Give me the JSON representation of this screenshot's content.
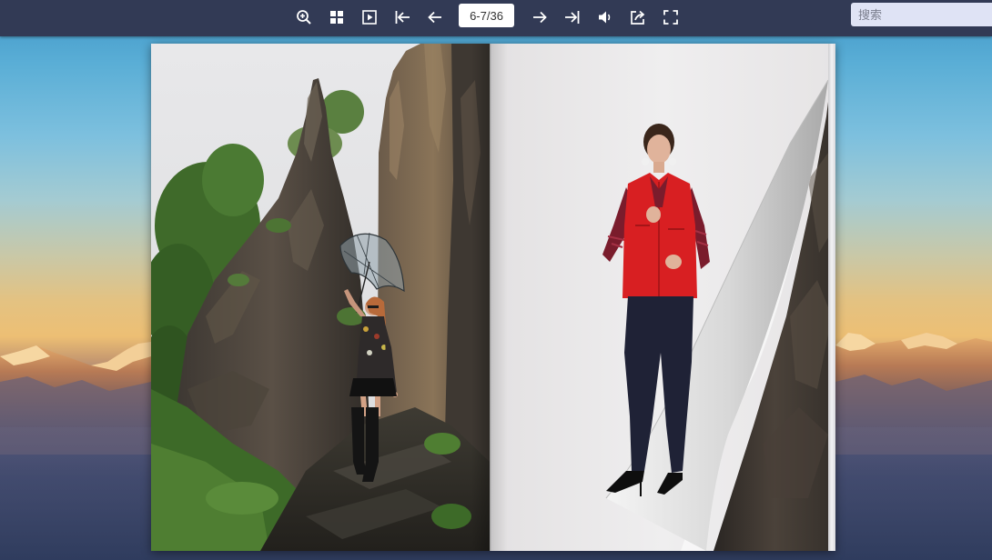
{
  "toolbar": {
    "tools": [
      {
        "name": "zoom-in",
        "icon": "zoom-in-icon"
      },
      {
        "name": "thumbnails",
        "icon": "grid-icon"
      },
      {
        "name": "autoplay",
        "icon": "play-icon"
      },
      {
        "name": "first-page",
        "icon": "first-page-icon"
      },
      {
        "name": "previous-page",
        "icon": "arrow-left-icon"
      },
      {
        "name": "next-page",
        "icon": "arrow-right-icon"
      },
      {
        "name": "last-page",
        "icon": "last-page-icon"
      },
      {
        "name": "sound",
        "icon": "speaker-icon"
      },
      {
        "name": "share",
        "icon": "share-icon"
      },
      {
        "name": "fullscreen",
        "icon": "fullscreen-icon"
      }
    ],
    "page_indicator": "6-7/36",
    "search": {
      "placeholder": "搜索",
      "value": ""
    }
  },
  "book": {
    "current_spread": "6-7",
    "total_pages": 36,
    "left_page": {
      "page_number": 6,
      "content": "photo-woman-with-umbrella-among-rocks"
    },
    "right_page": {
      "page_number": 7,
      "content": "photo-woman-in-red-vest",
      "page_curl": true
    }
  },
  "colors": {
    "toolbar_bg": "#323a55",
    "icon_color": "#ffffff",
    "search_bg": "#dfe3f5",
    "vest_red": "#d81f22"
  }
}
